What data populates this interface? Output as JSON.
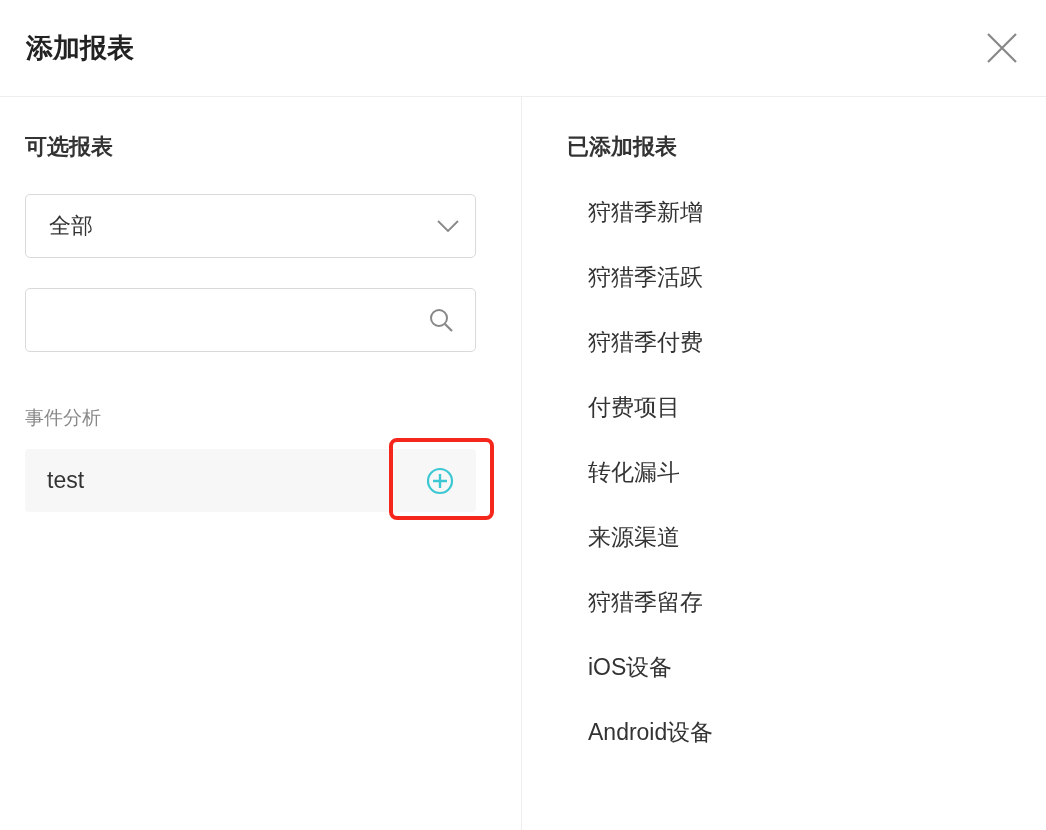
{
  "dialog": {
    "title": "添加报表"
  },
  "available": {
    "heading": "可选报表",
    "filter": {
      "value": "全部"
    },
    "groups": [
      {
        "label": "事件分析",
        "items": [
          {
            "name": "test",
            "highlighted": true
          }
        ]
      }
    ]
  },
  "added": {
    "heading": "已添加报表",
    "items": [
      "狩猎季新增",
      "狩猎季活跃",
      "狩猎季付费",
      "付费项目",
      "转化漏斗",
      "来源渠道",
      "狩猎季留存",
      "iOS设备",
      "Android设备"
    ]
  }
}
